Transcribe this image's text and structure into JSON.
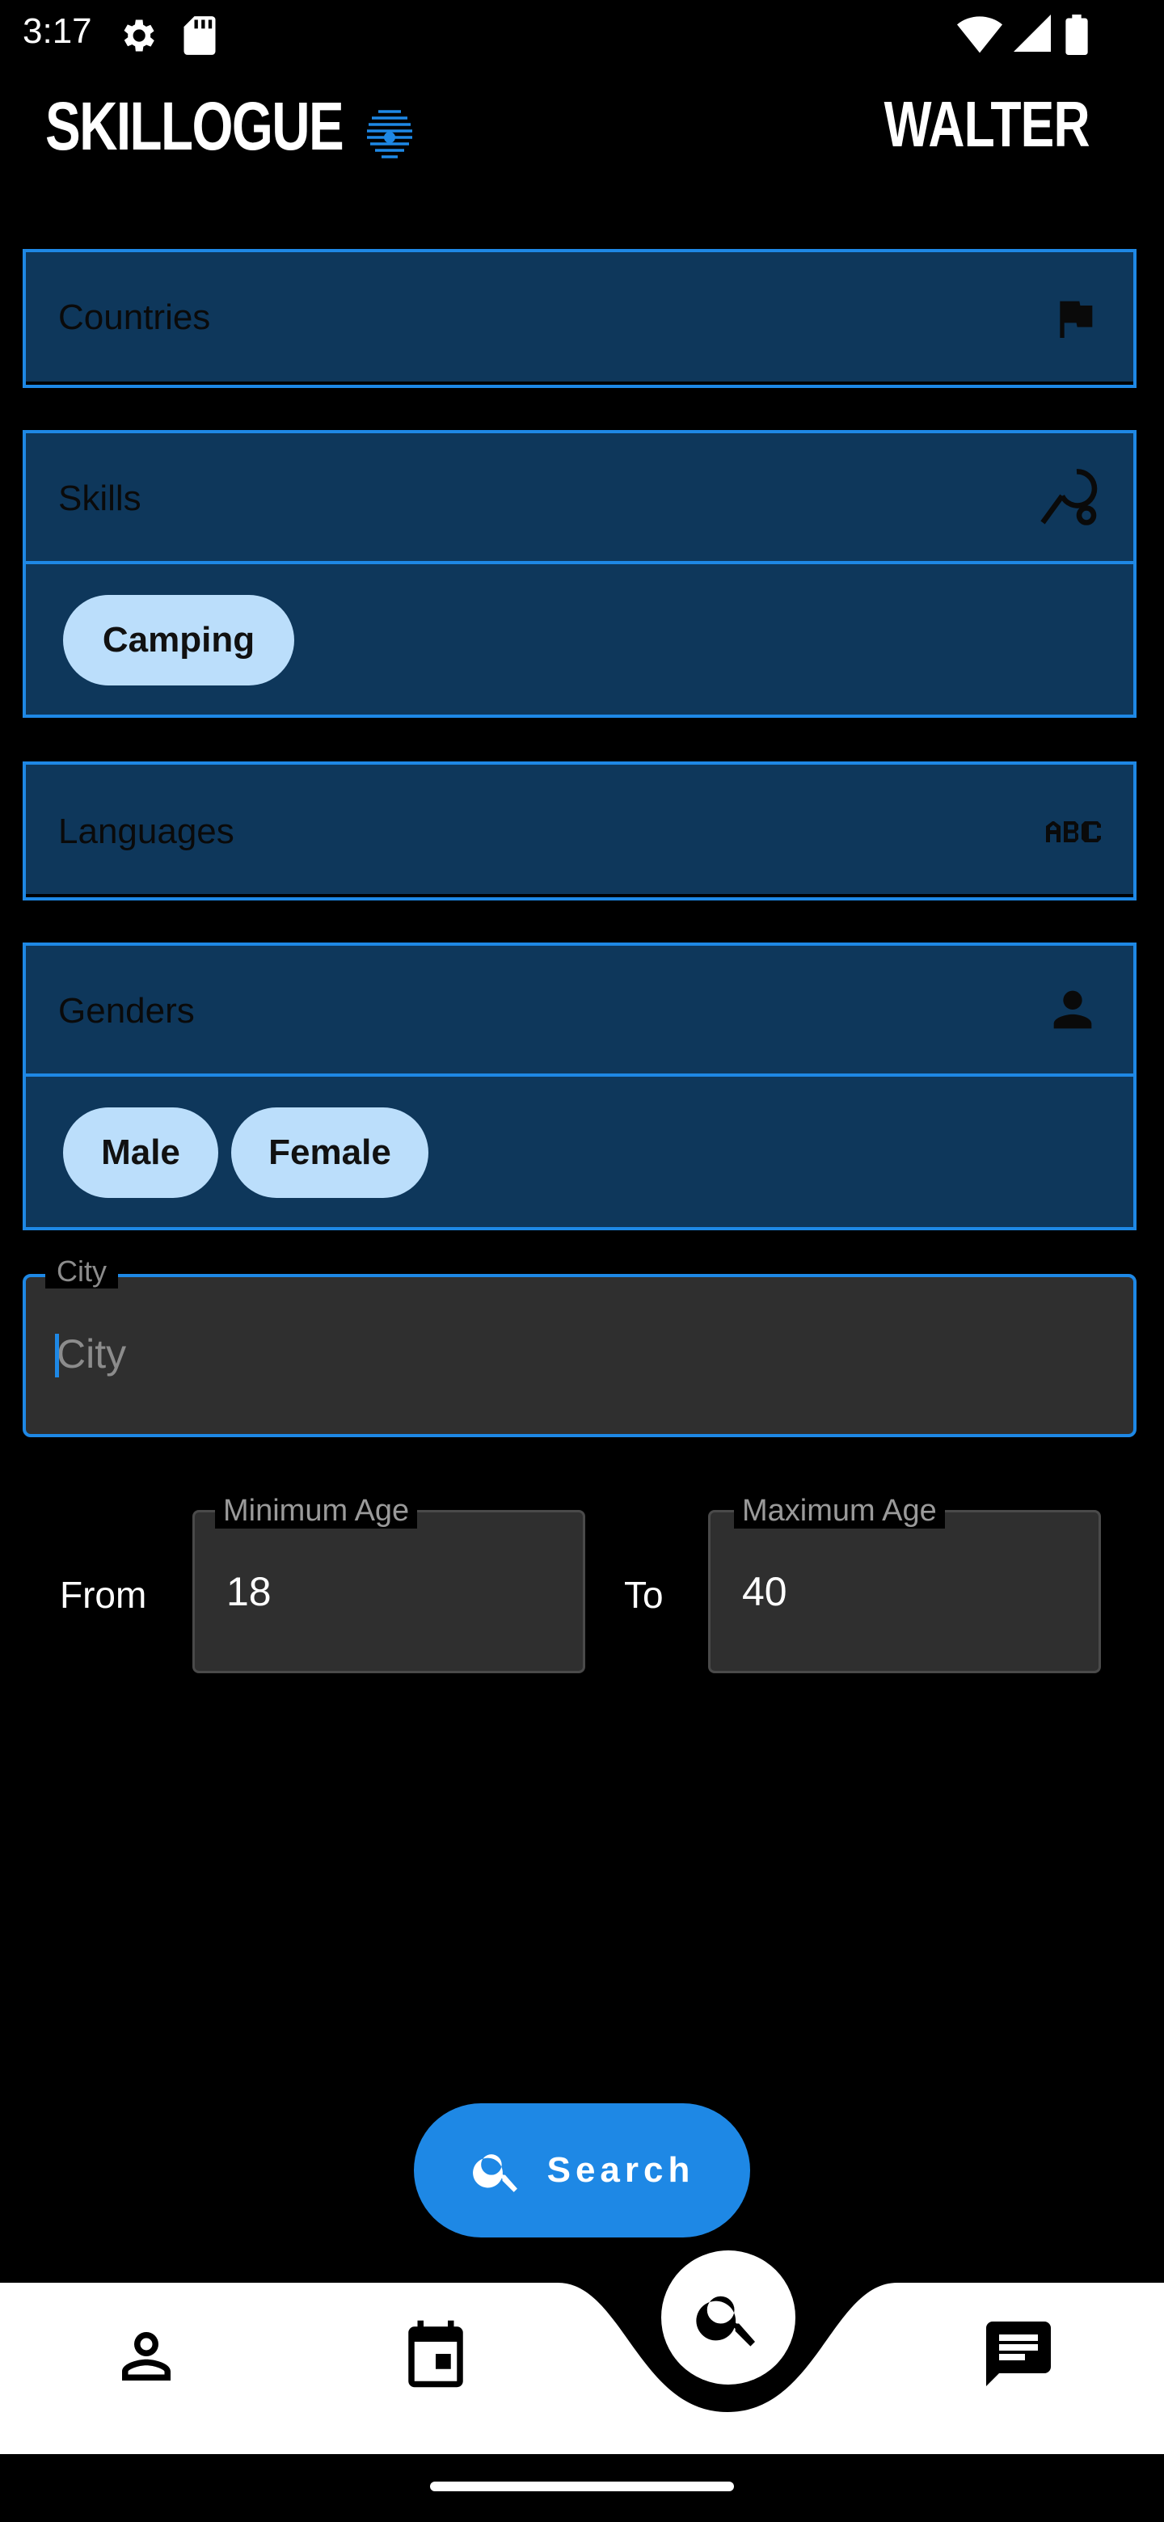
{
  "status_bar": {
    "time": "3:17"
  },
  "app_bar": {
    "brand": "SKILLOGUE",
    "user": "WALTER"
  },
  "filters": {
    "countries": {
      "label": "Countries",
      "icon": "flag-icon"
    },
    "skills": {
      "label": "Skills",
      "icon": "skills-icon",
      "chips": [
        "Camping"
      ]
    },
    "languages": {
      "label": "Languages",
      "icon": "abc-icon"
    },
    "genders": {
      "label": "Genders",
      "icon": "person-icon",
      "chips": [
        "Male",
        "Female"
      ]
    }
  },
  "city": {
    "legend": "City",
    "placeholder": "City"
  },
  "age": {
    "from_label": "From",
    "to_label": "To",
    "min_legend": "Minimum Age",
    "max_legend": "Maximum Age",
    "min_value": "18",
    "max_value": "40"
  },
  "search_button": {
    "label": "Search"
  },
  "colors": {
    "accent": "#1e88e5",
    "field_bg": "#0e375b",
    "chip_bg": "#bbdefb",
    "input_bg": "#2f2f2f"
  }
}
